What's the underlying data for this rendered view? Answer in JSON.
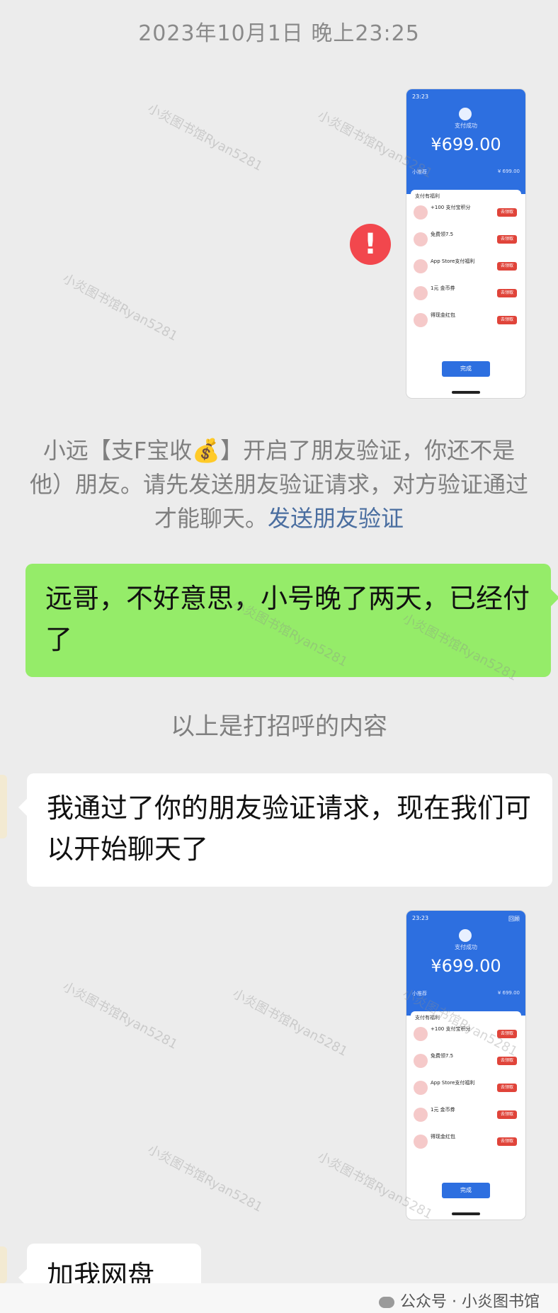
{
  "timestamp": "2023年10月1日 晚上23:25",
  "payment_screenshot": {
    "status_time": "23:23",
    "status_right": "",
    "page_title": "支付成功",
    "amount": "¥699.00",
    "row_left": "小推荐",
    "row_right": "¥ 699.00",
    "card_title": "支付有福利",
    "offers": [
      {
        "title": "+100 支付宝积分",
        "sub": "",
        "button": "去领取"
      },
      {
        "title": "免费领7.5",
        "sub": "",
        "button": "去领取"
      },
      {
        "title": "App Store支付福利",
        "sub": "",
        "button": "去领取"
      },
      {
        "title": "1元 金币券",
        "sub": "",
        "button": "去领取"
      },
      {
        "title": "得现金红包",
        "sub": "",
        "button": "去领取"
      }
    ],
    "done_button": "完成",
    "menu": "回顾"
  },
  "system_message": {
    "line1": "小远【支F宝收💰】开启了朋友验证，你还不是",
    "line2": "他）朋友。请先发送朋友验证请求，对方验证通过",
    "line3_text": "才能聊天。",
    "line3_link": "发送朋友验证"
  },
  "msg_sent": "远哥，不好意思，小号晚了两天，已经付了",
  "greeting_note": "以上是打招呼的内容",
  "msg_received": "我通过了你的朋友验证请求，现在我们可以开始聊天了",
  "msg_partial": "加我网盘",
  "watermark": "小炎图书馆Ryan5281",
  "footer": "公众号 · 小炎图书馆"
}
